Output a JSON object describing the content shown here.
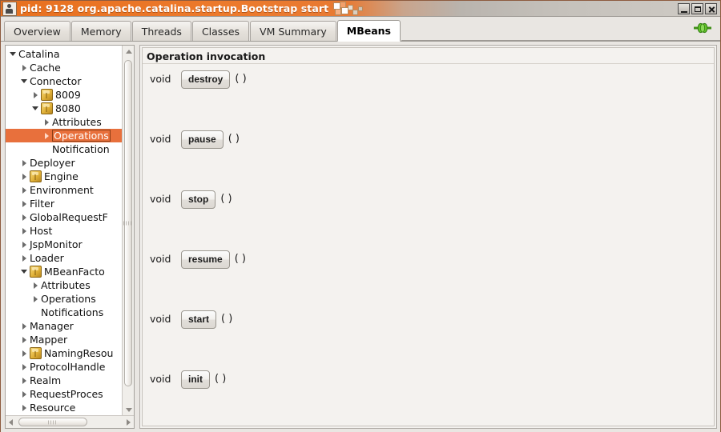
{
  "window": {
    "title": "pid: 9128 org.apache.catalina.startup.Bootstrap start",
    "app_icon": "java-duke-icon",
    "controls": [
      {
        "name": "minimize-button",
        "label": "–"
      },
      {
        "name": "maximize-button",
        "label": "□"
      },
      {
        "name": "close-button",
        "label": "✕"
      }
    ]
  },
  "tabs": [
    {
      "label": "Overview",
      "active": false
    },
    {
      "label": "Memory",
      "active": false
    },
    {
      "label": "Threads",
      "active": false
    },
    {
      "label": "Classes",
      "active": false
    },
    {
      "label": "VM Summary",
      "active": false
    },
    {
      "label": "MBeans",
      "active": true
    }
  ],
  "connection_icon": "green-plug-connected-icon",
  "tree": {
    "nodes": [
      {
        "label": "Catalina",
        "depth": 0,
        "twisty": "expanded",
        "mbean": false,
        "selected": false
      },
      {
        "label": "Cache",
        "depth": 1,
        "twisty": "collapsed",
        "mbean": false,
        "selected": false
      },
      {
        "label": "Connector",
        "depth": 1,
        "twisty": "expanded",
        "mbean": false,
        "selected": false
      },
      {
        "label": "8009",
        "depth": 2,
        "twisty": "collapsed",
        "mbean": true,
        "selected": false
      },
      {
        "label": "8080",
        "depth": 2,
        "twisty": "expanded",
        "mbean": true,
        "selected": false
      },
      {
        "label": "Attributes",
        "depth": 3,
        "twisty": "collapsed",
        "mbean": false,
        "selected": false
      },
      {
        "label": "Operations",
        "depth": 3,
        "twisty": "collapsed",
        "mbean": false,
        "selected": true
      },
      {
        "label": "Notification",
        "depth": 3,
        "twisty": "none",
        "mbean": false,
        "selected": false
      },
      {
        "label": "Deployer",
        "depth": 1,
        "twisty": "collapsed",
        "mbean": false,
        "selected": false
      },
      {
        "label": "Engine",
        "depth": 1,
        "twisty": "collapsed",
        "mbean": true,
        "selected": false
      },
      {
        "label": "Environment",
        "depth": 1,
        "twisty": "collapsed",
        "mbean": false,
        "selected": false
      },
      {
        "label": "Filter",
        "depth": 1,
        "twisty": "collapsed",
        "mbean": false,
        "selected": false
      },
      {
        "label": "GlobalRequestF",
        "depth": 1,
        "twisty": "collapsed",
        "mbean": false,
        "selected": false
      },
      {
        "label": "Host",
        "depth": 1,
        "twisty": "collapsed",
        "mbean": false,
        "selected": false
      },
      {
        "label": "JspMonitor",
        "depth": 1,
        "twisty": "collapsed",
        "mbean": false,
        "selected": false
      },
      {
        "label": "Loader",
        "depth": 1,
        "twisty": "collapsed",
        "mbean": false,
        "selected": false
      },
      {
        "label": "MBeanFacto",
        "depth": 1,
        "twisty": "expanded",
        "mbean": true,
        "selected": false
      },
      {
        "label": "Attributes",
        "depth": 2,
        "twisty": "collapsed",
        "mbean": false,
        "selected": false
      },
      {
        "label": "Operations",
        "depth": 2,
        "twisty": "collapsed",
        "mbean": false,
        "selected": false
      },
      {
        "label": "Notifications",
        "depth": 2,
        "twisty": "none",
        "mbean": false,
        "selected": false
      },
      {
        "label": "Manager",
        "depth": 1,
        "twisty": "collapsed",
        "mbean": false,
        "selected": false
      },
      {
        "label": "Mapper",
        "depth": 1,
        "twisty": "collapsed",
        "mbean": false,
        "selected": false
      },
      {
        "label": "NamingResou",
        "depth": 1,
        "twisty": "collapsed",
        "mbean": true,
        "selected": false
      },
      {
        "label": "ProtocolHandle",
        "depth": 1,
        "twisty": "collapsed",
        "mbean": false,
        "selected": false
      },
      {
        "label": "Realm",
        "depth": 1,
        "twisty": "collapsed",
        "mbean": false,
        "selected": false
      },
      {
        "label": "RequestProces",
        "depth": 1,
        "twisty": "collapsed",
        "mbean": false,
        "selected": false
      },
      {
        "label": "Resource",
        "depth": 1,
        "twisty": "collapsed",
        "mbean": false,
        "selected": false
      }
    ]
  },
  "operations_panel": {
    "header": "Operation invocation",
    "rows": [
      {
        "return_type": "void",
        "name": "destroy",
        "args": "( )"
      },
      {
        "return_type": "void",
        "name": "pause",
        "args": "( )"
      },
      {
        "return_type": "void",
        "name": "stop",
        "args": "( )"
      },
      {
        "return_type": "void",
        "name": "resume",
        "args": "( )"
      },
      {
        "return_type": "void",
        "name": "start",
        "args": "( )"
      },
      {
        "return_type": "void",
        "name": "init",
        "args": "( )"
      }
    ]
  },
  "colors": {
    "titlebar_accent": "#e8701f",
    "selection": "#e8703c",
    "selection_border": "#8c3d15",
    "mbean_icon": "#e0b038",
    "connected": "#49a21a",
    "pane_bg": "#f4f2ef"
  }
}
